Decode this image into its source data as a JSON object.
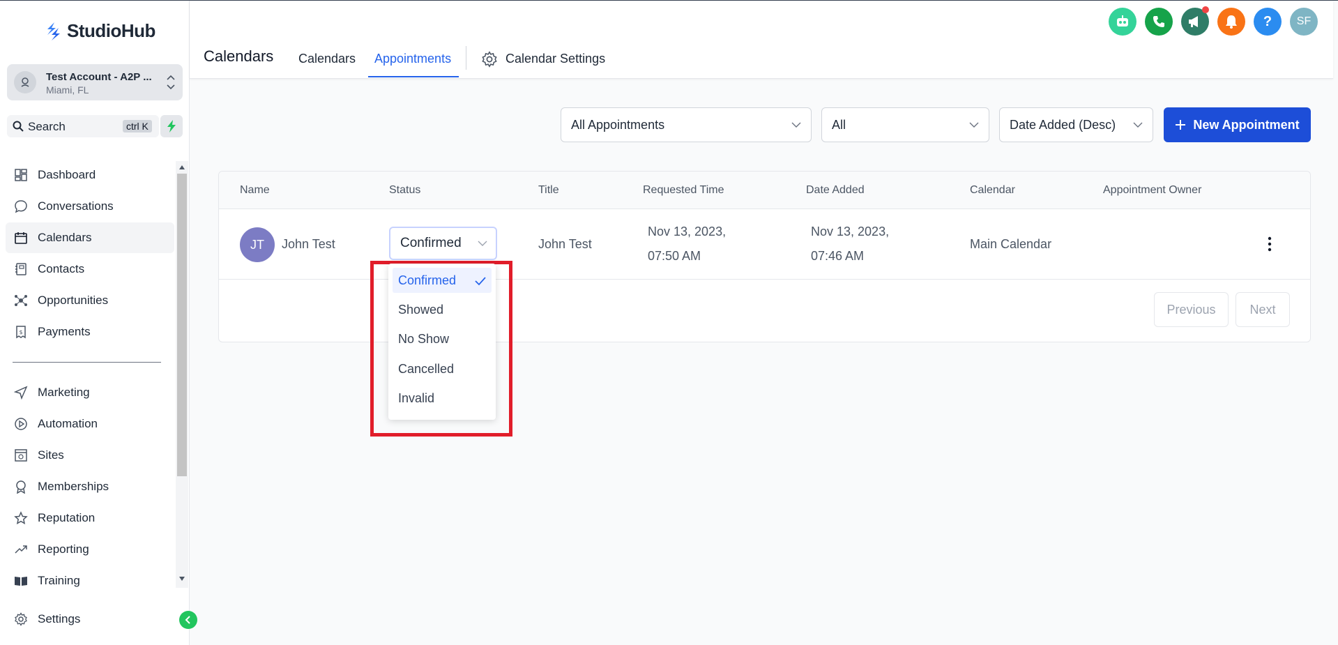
{
  "brand": {
    "name": "StudioHub",
    "accent": "#2563eb"
  },
  "account": {
    "name": "Test Account - A2P ...",
    "location": "Miami, FL"
  },
  "search": {
    "label": "Search",
    "shortcut": "ctrl K"
  },
  "sidebar": {
    "items": [
      {
        "label": "Dashboard",
        "icon": "dashboard-icon"
      },
      {
        "label": "Conversations",
        "icon": "chat-icon"
      },
      {
        "label": "Calendars",
        "icon": "calendar-icon",
        "active": true
      },
      {
        "label": "Contacts",
        "icon": "contacts-icon"
      },
      {
        "label": "Opportunities",
        "icon": "opportunities-icon"
      },
      {
        "label": "Payments",
        "icon": "payments-icon"
      },
      {
        "label": "Marketing",
        "icon": "send-icon"
      },
      {
        "label": "Automation",
        "icon": "automation-icon"
      },
      {
        "label": "Sites",
        "icon": "sites-icon"
      },
      {
        "label": "Memberships",
        "icon": "badge-icon"
      },
      {
        "label": "Reputation",
        "icon": "star-icon"
      },
      {
        "label": "Reporting",
        "icon": "trend-icon"
      },
      {
        "label": "Training",
        "icon": "book-icon"
      }
    ],
    "settings_label": "Settings"
  },
  "header": {
    "title": "Calendars",
    "tabs": [
      {
        "label": "Calendars"
      },
      {
        "label": "Appointments",
        "active": true
      },
      {
        "label": "Calendar Settings"
      }
    ],
    "user_initials": "SF",
    "help_glyph": "?"
  },
  "filters": {
    "appointment_type": "All Appointments",
    "status_filter": "All",
    "sort": "Date Added (Desc)",
    "new_button": "New Appointment"
  },
  "table": {
    "columns": [
      "Name",
      "Status",
      "Title",
      "Requested Time",
      "Date Added",
      "Calendar",
      "Appointment Owner"
    ],
    "rows": [
      {
        "initials": "JT",
        "name": "John Test",
        "status": "Confirmed",
        "title": "John Test",
        "requested_line1": "Nov 13, 2023,",
        "requested_line2": "07:50 AM",
        "added_line1": "Nov 13, 2023,",
        "added_line2": "07:46 AM",
        "calendar": "Main Calendar",
        "owner": ""
      }
    ],
    "pagination": {
      "previous": "Previous",
      "next": "Next"
    }
  },
  "status_dropdown": {
    "options": [
      "Confirmed",
      "Showed",
      "No Show",
      "Cancelled",
      "Invalid"
    ],
    "selected": "Confirmed"
  },
  "colors": {
    "primary_button": "#1d4ed8",
    "highlight_border": "#e11d2a",
    "avatar": "#7c7cc4",
    "icon_bot": "#34d399",
    "icon_phone": "#16a34a",
    "icon_megaphone": "#2f7d67",
    "icon_bell": "#f97316",
    "icon_help": "#2b8cf0",
    "icon_user": "#7fb5c4"
  }
}
